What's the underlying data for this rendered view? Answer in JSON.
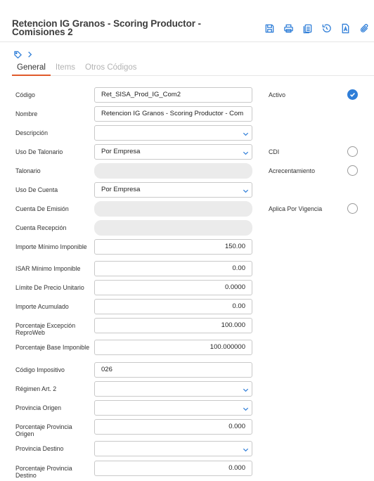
{
  "header": {
    "title": "Retencion IG Granos - Scoring Productor - Comisiones 2",
    "toolbar": [
      {
        "name": "save-icon"
      },
      {
        "name": "print-icon"
      },
      {
        "name": "copy-icon"
      },
      {
        "name": "undo-icon"
      },
      {
        "name": "document-a-icon"
      },
      {
        "name": "attach-icon"
      }
    ]
  },
  "breadcrumb": {
    "icons": [
      "tag-icon",
      "chevron-right-icon"
    ]
  },
  "tabs": [
    {
      "label": "General",
      "active": true
    },
    {
      "label": "Items",
      "active": false
    },
    {
      "label": "Otros Códigos",
      "active": false
    }
  ],
  "form": {
    "codigo": {
      "label": "Código",
      "value": "Ret_SISA_Prod_IG_Com2"
    },
    "nombre": {
      "label": "Nombre",
      "value": "Retencion IG Granos - Scoring Productor - Com"
    },
    "descripcion": {
      "label": "Descripción",
      "value": ""
    },
    "uso_talonario": {
      "label": "Uso De Talonario",
      "value": "Por Empresa"
    },
    "talonario": {
      "label": "Talonario",
      "value": ""
    },
    "uso_cuenta": {
      "label": "Uso De Cuenta",
      "value": "Por Empresa"
    },
    "cuenta_emision": {
      "label": "Cuenta De Emisión",
      "value": ""
    },
    "cuenta_recepcion": {
      "label": "Cuenta Recepción",
      "value": ""
    },
    "importe_minimo": {
      "label": "Importe Mínimo Imponible",
      "value": "150.00"
    },
    "isar_minimo": {
      "label": "ISAR Mínimo Imponible",
      "value": "0.00"
    },
    "limite_precio": {
      "label": "Límite De Precio Unitario",
      "value": "0.0000"
    },
    "importe_acumulado": {
      "label": "Importe Acumulado",
      "value": "0.00"
    },
    "porcentaje_excepcion": {
      "label": "Porcentaje Excepción ReproWeb",
      "value": "100.000"
    },
    "porcentaje_base": {
      "label": "Porcentaje Base Imponible",
      "value": "100.000000"
    },
    "codigo_impositivo": {
      "label": "Código Impositivo",
      "value": "026"
    },
    "regimen": {
      "label": "Régimen Art. 2",
      "value": ""
    },
    "provincia_origen": {
      "label": "Provincia Origen",
      "value": ""
    },
    "porcentaje_prov_origen": {
      "label": "Porcentaje Provincia Origen",
      "value": "0.000"
    },
    "provincia_destino": {
      "label": "Provincia Destino",
      "value": ""
    },
    "porcentaje_prov_destino": {
      "label": "Porcentaje Provincia Destino",
      "value": "0.000"
    }
  },
  "side": {
    "activo": {
      "label": "Activo",
      "checked": true
    },
    "cdi": {
      "label": "CDI",
      "checked": false
    },
    "acrecentamiento": {
      "label": "Acrecentamiento",
      "checked": false
    },
    "aplica_vigencia": {
      "label": "Aplica Por Vigencia",
      "checked": false
    }
  },
  "colors": {
    "accent": "#2f7ed8",
    "tab_indicator": "#e05a2b",
    "disabled_bg": "#ebebeb"
  }
}
